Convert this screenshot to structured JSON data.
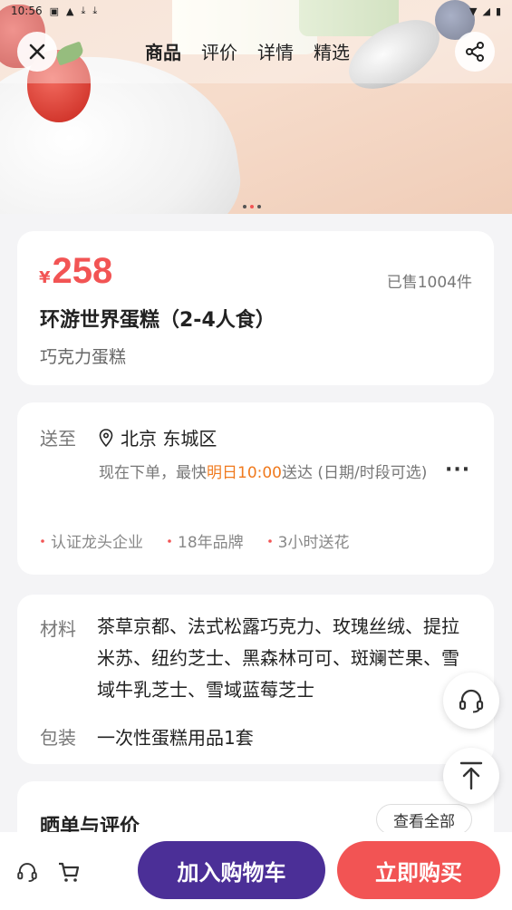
{
  "status_bar": {
    "time": "10:56"
  },
  "nav": {
    "tabs": [
      {
        "label": "商品",
        "active": true
      },
      {
        "label": "评价",
        "active": false
      },
      {
        "label": "详情",
        "active": false
      },
      {
        "label": "精选",
        "active": false
      }
    ],
    "close_icon": "close-icon",
    "share_icon": "share-icon"
  },
  "carousel": {
    "total": 3,
    "current": 2
  },
  "product": {
    "currency": "¥",
    "price": "258",
    "sold": "已售1004件",
    "title": "环游世界蛋糕（2-4人食）",
    "subtitle": "巧克力蛋糕"
  },
  "delivery": {
    "label": "送至",
    "location": "北京 东城区",
    "text_prefix": "现在下单，最快",
    "text_highlight": "明日10:00",
    "text_suffix": "送达 (日期/时段可选)",
    "badges": [
      "认证龙头企业",
      "18年品牌",
      "3小时送花"
    ]
  },
  "details": {
    "materials_label": "材料",
    "materials": "茶草京都、法式松露巧克力、玫瑰丝绒、提拉米苏、纽约芝士、黑森林可可、斑斓芒果、雪域牛乳芝士、雪域蓝莓芝士",
    "packaging_label": "包装",
    "packaging": "一次性蛋糕用品1套"
  },
  "reviews": {
    "title": "晒单与评价",
    "view_all": "查看全部"
  },
  "bottom_bar": {
    "add_to_cart": "加入购物车",
    "buy_now": "立即购买"
  },
  "colors": {
    "accent": "#f25454",
    "cart_button": "#4b2f97",
    "highlight": "#f07a1e"
  }
}
